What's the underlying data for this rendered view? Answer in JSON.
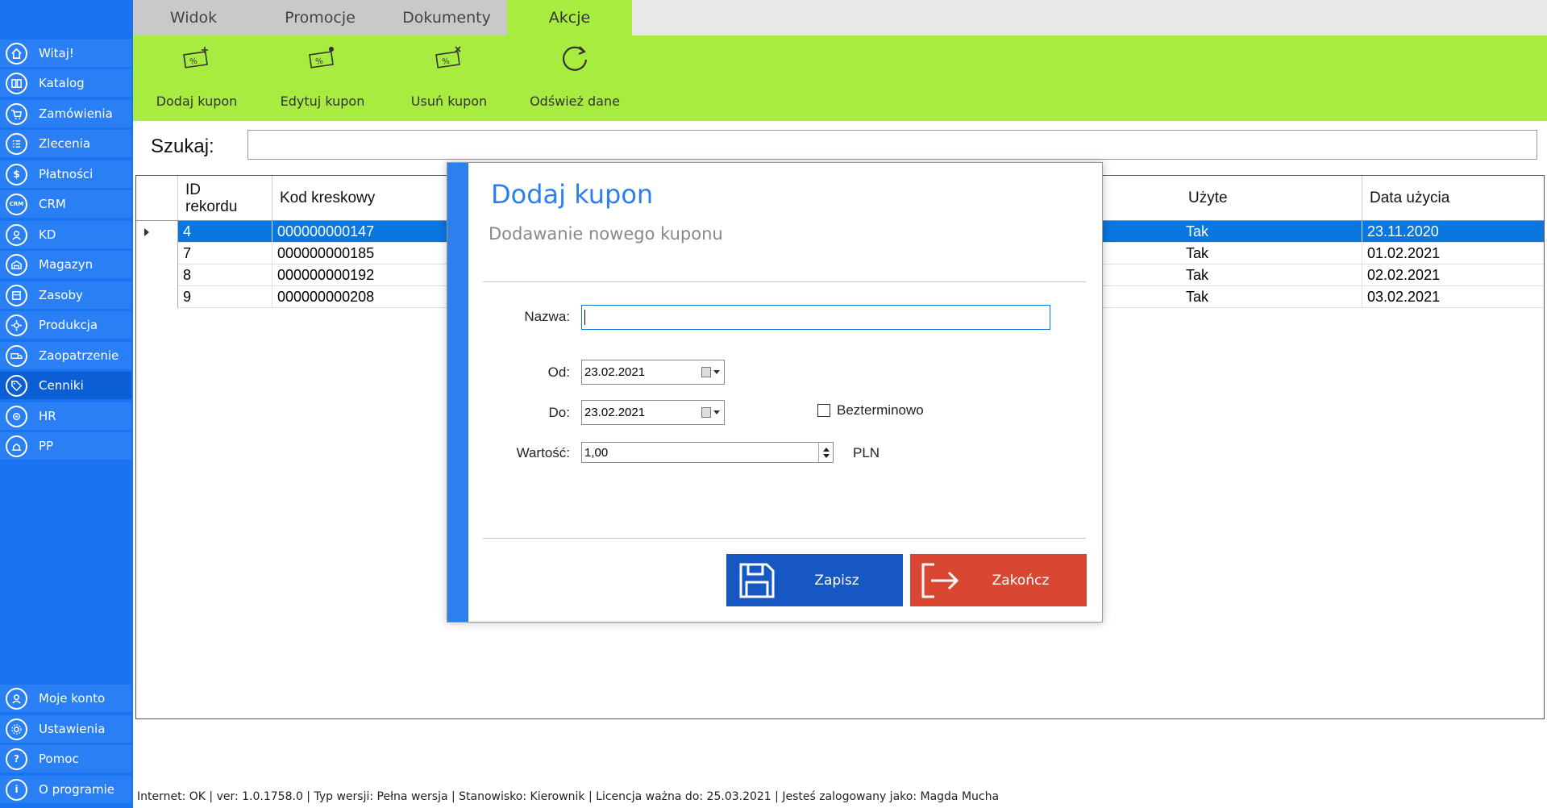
{
  "sidebar": {
    "items": [
      {
        "label": "Witaj!",
        "icon": "home-icon"
      },
      {
        "label": "Katalog",
        "icon": "book-icon"
      },
      {
        "label": "Zamówienia",
        "icon": "cart-icon"
      },
      {
        "label": "Zlecenia",
        "icon": "list-icon"
      },
      {
        "label": "Płatności",
        "icon": "dollar-icon"
      },
      {
        "label": "CRM",
        "icon": "crm-icon"
      },
      {
        "label": "KD",
        "icon": "badge-icon"
      },
      {
        "label": "Magazyn",
        "icon": "warehouse-icon"
      },
      {
        "label": "Zasoby",
        "icon": "resources-icon"
      },
      {
        "label": "Produkcja",
        "icon": "production-icon"
      },
      {
        "label": "Zaopatrzenie",
        "icon": "truck-icon"
      },
      {
        "label": "Cenniki",
        "icon": "tag-icon"
      },
      {
        "label": "HR",
        "icon": "hr-icon"
      },
      {
        "label": "PP",
        "icon": "pp-icon"
      }
    ],
    "bottom_items": [
      {
        "label": "Moje konto",
        "icon": "user-icon"
      },
      {
        "label": "Ustawienia",
        "icon": "gear-icon"
      },
      {
        "label": "Pomoc",
        "icon": "help-icon"
      },
      {
        "label": "O programie",
        "icon": "info-icon"
      }
    ]
  },
  "tabs": [
    {
      "label": "Widok"
    },
    {
      "label": "Promocje"
    },
    {
      "label": "Dokumenty"
    },
    {
      "label": "Akcje"
    }
  ],
  "ribbon": {
    "buttons": [
      {
        "label": "Dodaj kupon",
        "icon": "coupon-add-icon"
      },
      {
        "label": "Edytuj kupon",
        "icon": "coupon-edit-icon"
      },
      {
        "label": "Usuń kupon",
        "icon": "coupon-delete-icon"
      },
      {
        "label": "Odśwież dane",
        "icon": "refresh-icon"
      }
    ]
  },
  "search": {
    "label": "Szukaj:",
    "value": ""
  },
  "grid": {
    "columns": [
      {
        "label": "ID\nrekordu"
      },
      {
        "label": "Kod kreskowy"
      },
      {
        "label": "Użyte"
      },
      {
        "label": "Data użycia"
      }
    ],
    "rows": [
      {
        "id": "4",
        "barcode": "000000000147",
        "used": "Tak",
        "date": "23.11.2020"
      },
      {
        "id": "7",
        "barcode": "000000000185",
        "used": "Tak",
        "date": "01.02.2021"
      },
      {
        "id": "8",
        "barcode": "000000000192",
        "used": "Tak",
        "date": "02.02.2021"
      },
      {
        "id": "9",
        "barcode": "000000000208",
        "used": "Tak",
        "date": "03.02.2021"
      }
    ],
    "selected_row": 0
  },
  "dialog": {
    "title": "Dodaj kupon",
    "subtitle": "Dodawanie nowego kuponu",
    "name_label": "Nazwa:",
    "name_value": "",
    "from_label": "Od:",
    "from_value": "23.02.2021",
    "to_label": "Do:",
    "to_value": "23.02.2021",
    "unlimited_label": "Bezterminowo",
    "value_label": "Wartość:",
    "value_value": "1,00",
    "unit": "PLN",
    "save_label": "Zapisz",
    "close_label": "Zakończ"
  },
  "statusbar": {
    "text": "Internet: OK  |   ver: 1.0.1758.0   |   Typ wersji: Pełna wersja   |   Stanowisko: Kierownik   |   Licencja ważna do: 25.03.2021   |   Jesteś zalogowany jako: Magda Mucha"
  },
  "colors": {
    "sidebar_bg": "#1a73f0",
    "ribbon_bg": "#a8ec40",
    "accent_blue": "#2d7ff0",
    "save_button": "#1657c4",
    "close_button": "#d94631",
    "selected_row": "#0a76e0"
  }
}
